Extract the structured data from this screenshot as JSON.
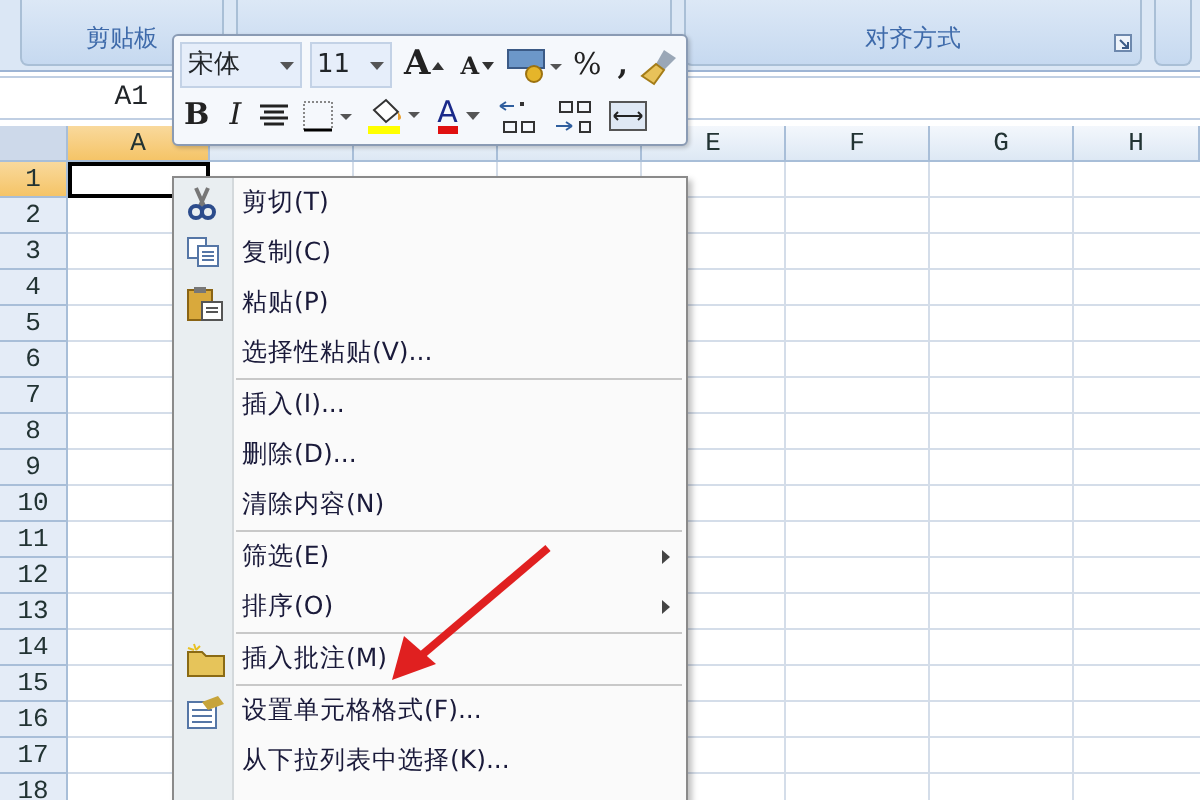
{
  "ribbon": {
    "groups": [
      {
        "label": "剪贴板",
        "launcher": false
      },
      {
        "label": "对齐方式",
        "launcher": true
      }
    ]
  },
  "name_box": {
    "value": "A1"
  },
  "sheet": {
    "columns": [
      {
        "label": "A",
        "selected": true
      },
      {
        "selected": false
      },
      {
        "selected": false
      },
      {
        "selected": false
      },
      {
        "label": "E",
        "selected": false
      },
      {
        "label": "F",
        "selected": false
      },
      {
        "label": "G",
        "selected": false
      },
      {
        "label": "H",
        "selected": false
      }
    ],
    "rows": [
      {
        "label": "1",
        "selected": true
      },
      {
        "label": "2",
        "selected": false
      },
      {
        "label": "3",
        "selected": false
      },
      {
        "label": "4",
        "selected": false
      },
      {
        "label": "5",
        "selected": false
      },
      {
        "label": "6",
        "selected": false
      },
      {
        "label": "7",
        "selected": false
      },
      {
        "label": "8",
        "selected": false
      },
      {
        "label": "9",
        "selected": false
      },
      {
        "label": "10",
        "selected": false
      },
      {
        "label": "11",
        "selected": false
      },
      {
        "label": "12",
        "selected": false
      },
      {
        "label": "13",
        "selected": false
      },
      {
        "label": "14",
        "selected": false
      },
      {
        "label": "15",
        "selected": false
      },
      {
        "label": "16",
        "selected": false
      },
      {
        "label": "17",
        "selected": false
      },
      {
        "label": "18",
        "selected": false
      }
    ]
  },
  "mini_toolbar": {
    "font": "宋体",
    "size": "11",
    "rows": [
      [
        {
          "kind": "grow",
          "label": "A"
        },
        {
          "kind": "shrink",
          "label": "A"
        },
        {
          "kind": "accounting"
        },
        {
          "kind": "percent",
          "label": "%"
        },
        {
          "kind": "comma",
          "label": ","
        },
        {
          "kind": "painter"
        }
      ],
      [
        {
          "kind": "bold",
          "label": "B"
        },
        {
          "kind": "italic",
          "label": "I"
        },
        {
          "kind": "center"
        },
        {
          "kind": "border"
        },
        {
          "kind": "fill"
        },
        {
          "kind": "fontcolor",
          "label": "A"
        },
        {
          "kind": "incdec"
        },
        {
          "kind": "decdec"
        },
        {
          "kind": "merge"
        }
      ]
    ]
  },
  "context_menu": {
    "items": [
      {
        "kind": "cut",
        "label": "剪切(T)"
      },
      {
        "kind": "copy",
        "label": "复制(C)"
      },
      {
        "kind": "paste",
        "label": "粘贴(P)"
      },
      {
        "kind": "command",
        "label": "选择性粘贴(V)..."
      },
      {
        "kind": "separator"
      },
      {
        "kind": "command",
        "label": "插入(I)..."
      },
      {
        "kind": "command",
        "label": "删除(D)..."
      },
      {
        "kind": "command",
        "label": "清除内容(N)"
      },
      {
        "kind": "separator"
      },
      {
        "kind": "submenu",
        "label": "筛选(E)"
      },
      {
        "kind": "submenu",
        "label": "排序(O)"
      },
      {
        "kind": "separator"
      },
      {
        "kind": "comment",
        "label": "插入批注(M)"
      },
      {
        "kind": "separator"
      },
      {
        "kind": "format",
        "label": "设置单元格格式(F)..."
      },
      {
        "kind": "command",
        "label": "从下拉列表中选择(K)..."
      }
    ]
  }
}
